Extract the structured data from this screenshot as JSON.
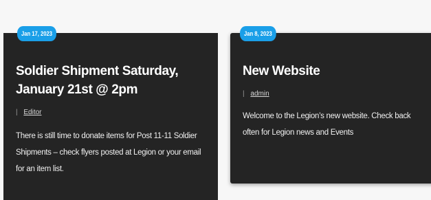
{
  "posts": [
    {
      "date": "Jan 17, 2023",
      "title": "Soldier Shipment Saturday, January 21st @ 2pm",
      "separator": "|",
      "author": "Editor",
      "excerpt": "There is still time to donate items for Post 11-11 Soldier Shipments – check flyers posted at Legion or your email for an item list."
    },
    {
      "date": "Jan 8, 2023",
      "title": "New Website",
      "separator": "|",
      "author": "admin",
      "excerpt": "Welcome to the Legion’s new website. Check back often for Legion news and Events"
    }
  ],
  "colors": {
    "card_background": "#242424",
    "badge_background": "#1a9fe8",
    "page_background": "#f7f7f7"
  }
}
